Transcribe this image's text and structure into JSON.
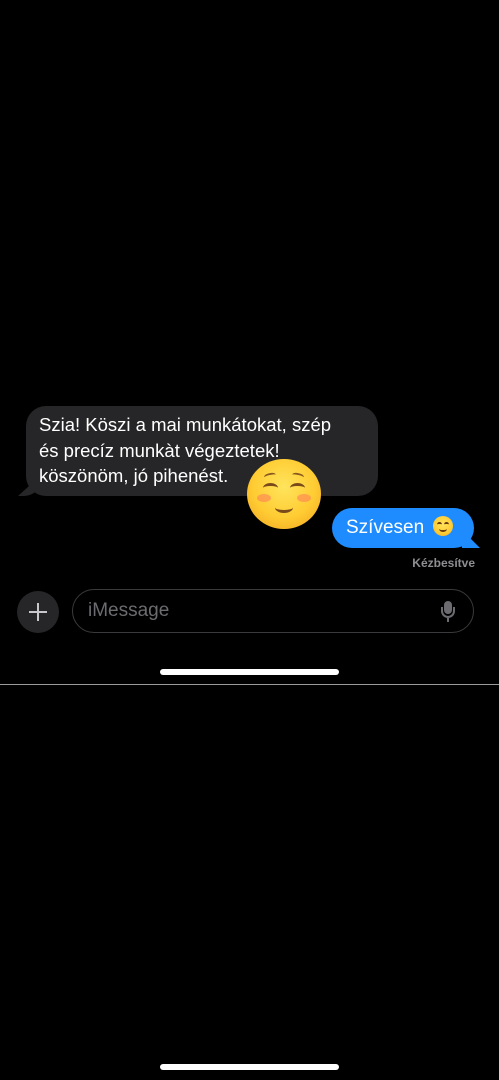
{
  "conversation": {
    "incoming_message": {
      "lines": [
        "Szia! Köszi a mai munkátokat, szép",
        "és precíz munkàt végeztetek!",
        "köszönöm, jó pihenést."
      ],
      "tapback_icon": "smiling-face-with-rosy-cheeks-icon"
    },
    "outgoing_message": {
      "text": "Szívesen",
      "emoji_icon": "smiling-face-icon"
    },
    "delivery_status": "Kézbesítve"
  },
  "composer": {
    "placeholder": "iMessage",
    "add_icon": "plus-icon",
    "mic_icon": "microphone-icon"
  },
  "colors": {
    "background": "#000000",
    "incoming_bubble": "#262628",
    "outgoing_bubble": "#1e8cff",
    "status_text": "#8e8e93"
  }
}
